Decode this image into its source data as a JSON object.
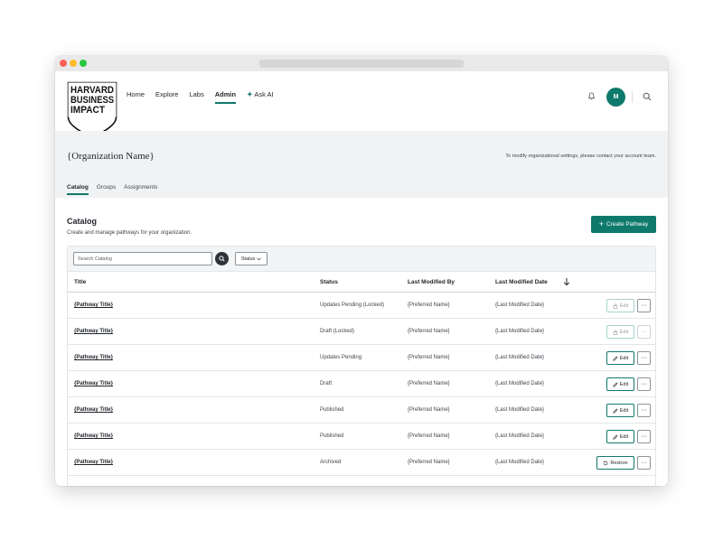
{
  "brand": {
    "logo_lines": [
      "HARVARD",
      "BUSINESS",
      "IMPACT"
    ],
    "accent_color": "#0f7a6c"
  },
  "nav": {
    "links": [
      {
        "label": "Home",
        "active": false
      },
      {
        "label": "Explore",
        "active": false
      },
      {
        "label": "Labs",
        "active": false
      },
      {
        "label": "Admin",
        "active": true
      },
      {
        "label": "Ask AI",
        "active": false
      }
    ],
    "avatar_initial": "M",
    "icons": [
      "bell-icon",
      "search-icon",
      "sparkle-icon"
    ]
  },
  "org": {
    "name": "{Organization Name}",
    "note": "To modify organizational settings, please contact your account team.",
    "tabs": [
      {
        "label": "Catalog",
        "active": true
      },
      {
        "label": "Groups",
        "active": false
      },
      {
        "label": "Assignments",
        "active": false
      }
    ]
  },
  "catalog": {
    "title": "Catalog",
    "subtitle": "Create and manage pathways for your organization.",
    "create_label": "Create Pathway",
    "search_placeholder": "Search Catalog",
    "status_filter_label": "Status",
    "columns": [
      "Title",
      "Status",
      "Last Modified By",
      "Last Modified Date"
    ],
    "rows": [
      {
        "title": "{Pathway Title}",
        "status": "Updates Pending (Locked)",
        "modified_by": "{Preferred Name}",
        "modified_date": "{Last Modified Date}",
        "action": "Edit",
        "action_icon": "lock-icon",
        "action_enabled": false,
        "more_enabled": true
      },
      {
        "title": "{Pathway Title}",
        "status": "Draft (Locked)",
        "modified_by": "{Preferred Name}",
        "modified_date": "{Last Modified Date}",
        "action": "Edit",
        "action_icon": "lock-icon",
        "action_enabled": false,
        "more_enabled": false
      },
      {
        "title": "{Pathway Title}",
        "status": "Updates Pending",
        "modified_by": "{Preferred Name}",
        "modified_date": "{Last Modified Date}",
        "action": "Edit",
        "action_icon": "pencil-icon",
        "action_enabled": true,
        "more_enabled": true
      },
      {
        "title": "{Pathway Title}",
        "status": "Draft",
        "modified_by": "{Preferred Name}",
        "modified_date": "{Last Modified Date}",
        "action": "Edit",
        "action_icon": "pencil-icon",
        "action_enabled": true,
        "more_enabled": true
      },
      {
        "title": "{Pathway Title}",
        "status": "Published",
        "modified_by": "{Preferred Name}",
        "modified_date": "{Last Modified Date}",
        "action": "Edit",
        "action_icon": "pencil-icon",
        "action_enabled": true,
        "more_enabled": true
      },
      {
        "title": "{Pathway Title}",
        "status": "Published",
        "modified_by": "{Preferred Name}",
        "modified_date": "{Last Modified Date}",
        "action": "Edit",
        "action_icon": "pencil-icon",
        "action_enabled": true,
        "more_enabled": true
      },
      {
        "title": "{Pathway Title}",
        "status": "Archived",
        "modified_by": "{Preferred Name}",
        "modified_date": "{Last Modified Date}",
        "action": "Restore",
        "action_icon": "restore-icon",
        "action_enabled": true,
        "more_enabled": true
      }
    ],
    "more_label": "···"
  }
}
